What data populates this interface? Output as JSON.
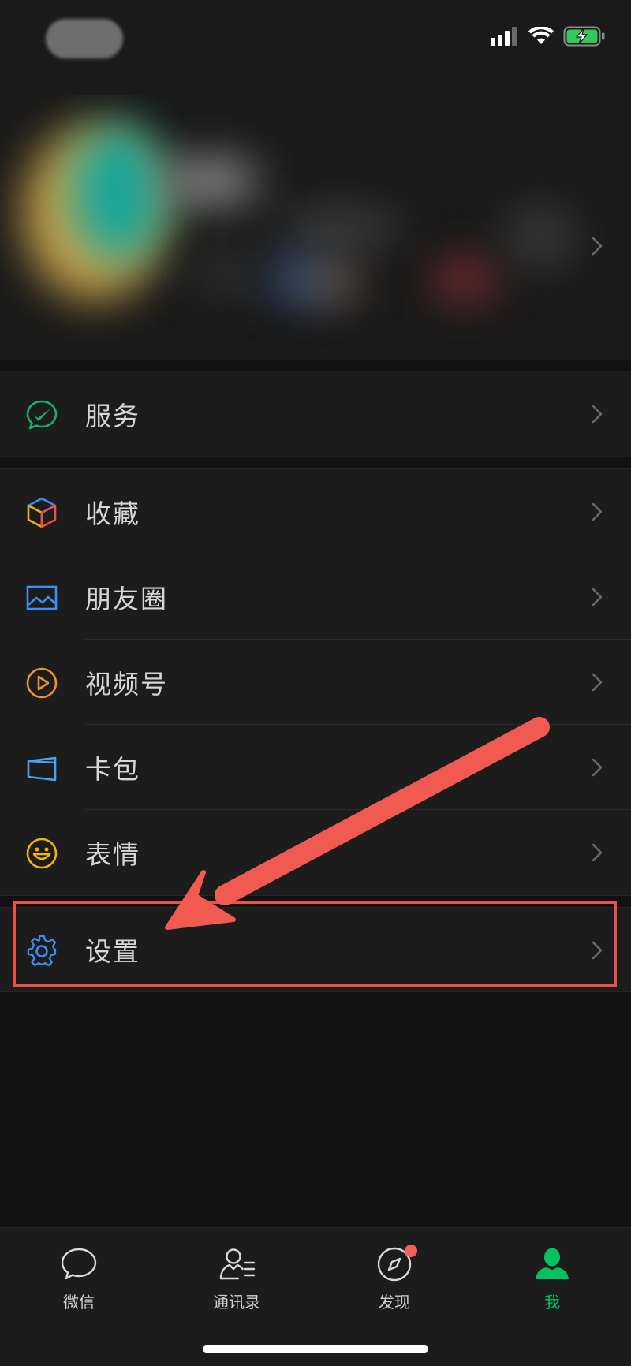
{
  "status_bar": {
    "icons": [
      "signal-icon",
      "wifi-icon",
      "battery-charging-icon"
    ]
  },
  "colors": {
    "accent_green": "#07c160",
    "annotation_red": "#e8524a",
    "badge_red": "#f25e5e"
  },
  "menu": {
    "group1": [
      {
        "label": "服务",
        "icon": "service-icon"
      }
    ],
    "group2": [
      {
        "label": "收藏",
        "icon": "favorites-cube-icon"
      },
      {
        "label": "朋友圈",
        "icon": "moments-image-icon"
      },
      {
        "label": "视频号",
        "icon": "channels-play-icon"
      },
      {
        "label": "卡包",
        "icon": "card-wallet-icon"
      },
      {
        "label": "表情",
        "icon": "sticker-smile-icon"
      }
    ],
    "group3": [
      {
        "label": "设置",
        "icon": "settings-gear-icon"
      }
    ]
  },
  "tabbar": {
    "tabs": [
      {
        "label": "微信",
        "icon": "chat-bubble-icon"
      },
      {
        "label": "通讯录",
        "icon": "contacts-icon"
      },
      {
        "label": "发现",
        "icon": "compass-icon"
      },
      {
        "label": "我",
        "icon": "me-person-icon"
      }
    ],
    "active_index": 3
  }
}
